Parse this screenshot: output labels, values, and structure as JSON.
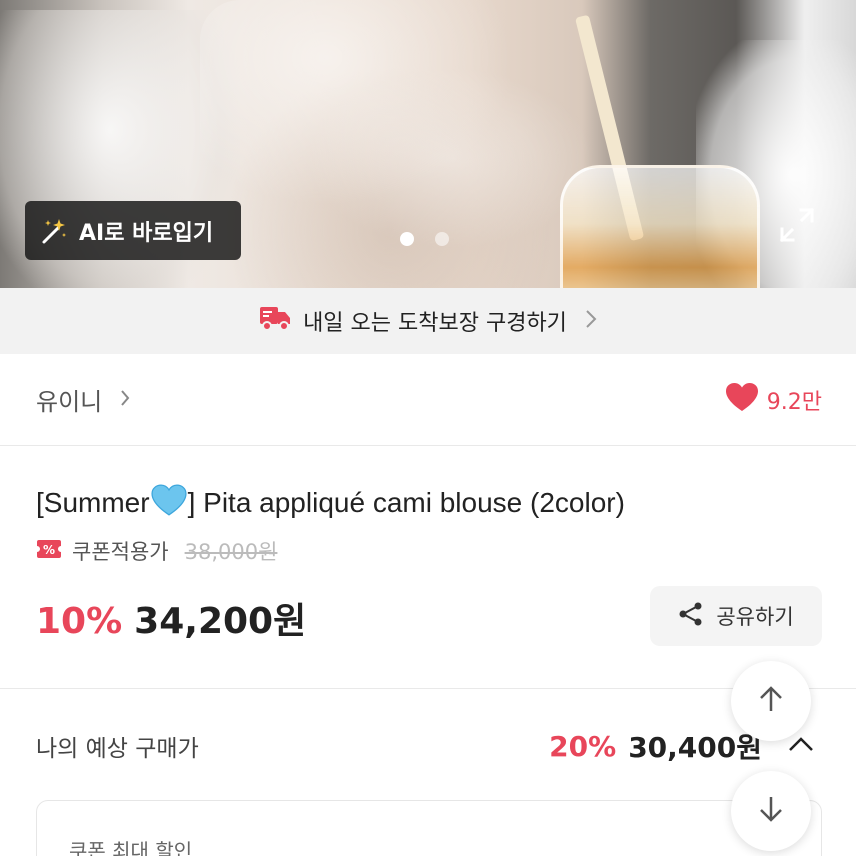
{
  "hero": {
    "ai_button_label": "AI로 바로입기",
    "carousel": {
      "total": 2,
      "active": 1
    }
  },
  "delivery_banner": {
    "label": "내일 오는 도착보장 구경하기"
  },
  "brand": {
    "name": "유이니",
    "likes": "9.2만"
  },
  "product": {
    "title_prefix": "[Summer",
    "title_suffix": "] Pita appliqué cami blouse (2color)",
    "coupon_label": "쿠폰적용가",
    "original_price": "38,000원",
    "discount": "10%",
    "price": "34,200원",
    "share_label": "공유하기"
  },
  "expected": {
    "label": "나의 예상 구매가",
    "discount": "20%",
    "price": "30,400원"
  },
  "coupon_box": {
    "label": "쿠폰 최대 할인"
  },
  "colors": {
    "accent": "#e8465a",
    "text": "#222222",
    "muted": "#999999",
    "banner_bg": "#f2f2f2",
    "heart_emoji": "#5bc0eb"
  }
}
